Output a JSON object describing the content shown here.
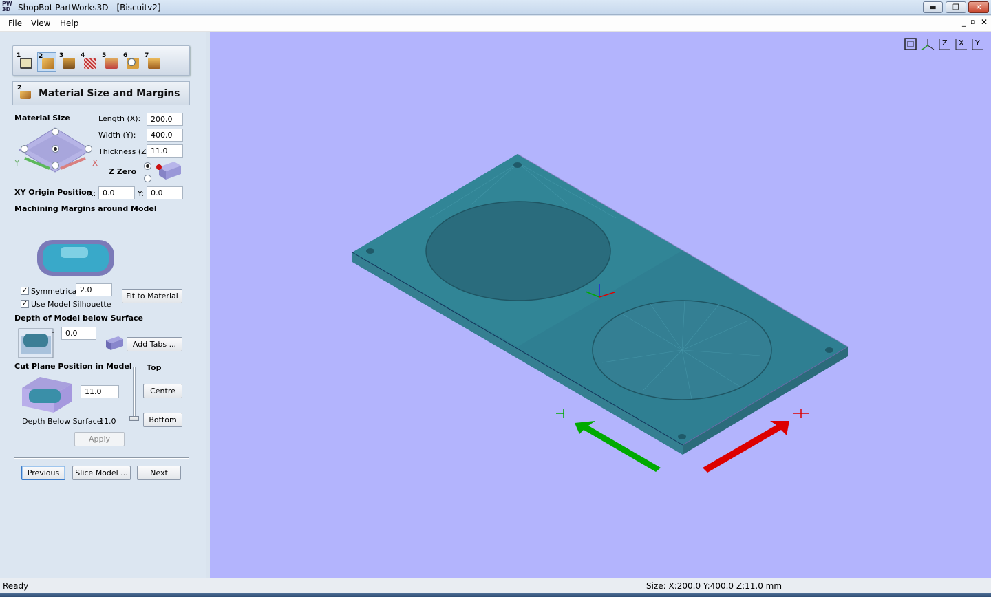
{
  "window": {
    "app_icon": "PW 3D",
    "title": "ShopBot PartWorks3D - [Biscuitv2]",
    "min_label": "▬",
    "max_label": "❐",
    "close_label": "✕"
  },
  "menu": {
    "items": [
      "File",
      "View",
      "Help"
    ],
    "mdi_min": "_",
    "mdi_restore": "▫",
    "mdi_close": "✕"
  },
  "steps": {
    "numbers": [
      "1",
      "2",
      "3",
      "4",
      "5",
      "6",
      "7"
    ],
    "active_index": 1
  },
  "panel": {
    "header_number": "2",
    "header_title": "Material Size and Margins",
    "material_size_label": "Material Size",
    "length_label": "Length (X):",
    "length_value": "200.0",
    "width_label": "Width (Y):",
    "width_value": "400.0",
    "thickness_label": "Thickness (Z):",
    "thickness_value": "11.0",
    "z_zero_label": "Z Zero",
    "axis_y": "Y",
    "axis_x": "X",
    "xy_origin_label": "XY Origin Position",
    "origin_x_label": "X:",
    "origin_x_value": "0.0",
    "origin_y_label": "Y:",
    "origin_y_value": "0.0",
    "margins_label": "Machining Margins around Model",
    "symmetrical_label": "Symmetrical",
    "symmetrical_value": "2.0",
    "fit_button": "Fit to Material",
    "silhouette_label": "Use Model Silhouette",
    "depth_label": "Depth of Model below Surface",
    "depth_value": "0.0",
    "add_tabs_button": "Add Tabs ...",
    "cut_plane_label": "Cut Plane Position in Model",
    "cut_plane_value": "11.0",
    "top_label": "Top",
    "centre_button": "Centre",
    "bottom_button": "Bottom",
    "depth_below_label": "Depth Below Surface:",
    "depth_below_value": "11.0",
    "apply_button": "Apply",
    "previous_button": "Previous",
    "slice_button": "Slice Model ...",
    "next_button": "Next"
  },
  "viewport": {
    "background": "#b3b4fd",
    "model_color": "#2f7f92",
    "x_arrow_color": "#dd0000",
    "y_arrow_color": "#00aa00",
    "view_icons": [
      "zoom-all-icon",
      "view-iso-icon",
      "view-z-icon",
      "view-x-icon",
      "view-y-icon"
    ],
    "view_icon_labels": [
      "",
      "Z",
      "Z",
      "X",
      "Y"
    ]
  },
  "status": {
    "ready": "Ready",
    "size": "Size: X:200.0 Y:400.0 Z:11.0 mm"
  }
}
